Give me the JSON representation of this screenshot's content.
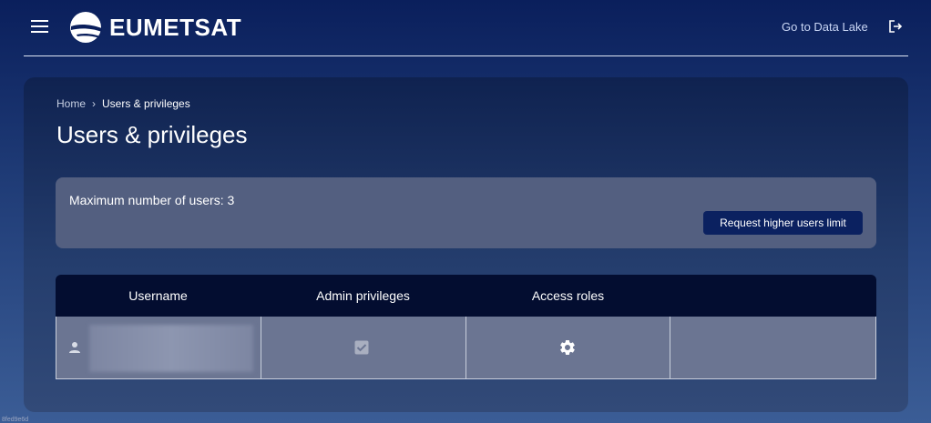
{
  "header": {
    "brand": "EUMETSAT",
    "data_lake_link": "Go to Data Lake"
  },
  "breadcrumb": {
    "home": "Home",
    "separator": "›",
    "current": "Users & privileges"
  },
  "page": {
    "title": "Users & privileges"
  },
  "limits": {
    "max_users_text": "Maximum number of users: 3",
    "request_button": "Request higher users limit"
  },
  "table": {
    "columns": [
      "Username",
      "Admin privileges",
      "Access roles",
      ""
    ],
    "rows": [
      {
        "username": "",
        "admin": true,
        "access_roles_icon": "gear-icon"
      }
    ]
  },
  "footer": {
    "id": "8fed9e6d"
  },
  "colors": {
    "accent_button": "#0b2160",
    "table_header": "#030d30",
    "panel": "#535f80"
  }
}
